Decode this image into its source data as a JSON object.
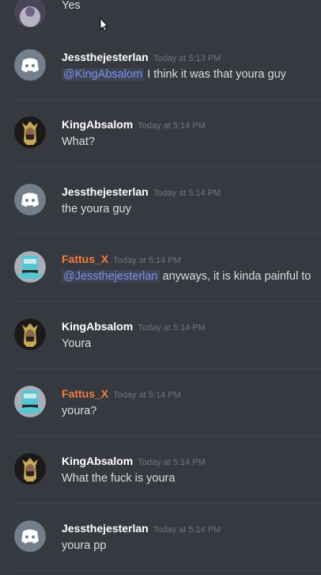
{
  "top_partial": {
    "content": "Yes"
  },
  "messages": [
    {
      "author": "Jessthejesterlan",
      "timestamp": "Today at 5:13 PM",
      "mention": "@KingAbsalom",
      "text": "I think it was that youra guy",
      "avatar": "discord-logo-icon"
    },
    {
      "author": "KingAbsalom",
      "timestamp": "Today at 5:14 PM",
      "mention": "",
      "text": "What?",
      "avatar": "king-avatar"
    },
    {
      "author": "Jessthejesterlan",
      "timestamp": "Today at 5:14 PM",
      "mention": "",
      "text": "the youra guy",
      "avatar": "discord-logo-icon"
    },
    {
      "author": "Fattus_X",
      "timestamp": "Today at 5:14 PM",
      "mention": "@Jessthejesterlan",
      "text": "anyways, it is kinda painful to",
      "avatar": "hat-avatar"
    },
    {
      "author": "KingAbsalom",
      "timestamp": "Today at 5:14 PM",
      "mention": "",
      "text": "Youra",
      "avatar": "king-avatar"
    },
    {
      "author": "Fattus_X",
      "timestamp": "Today at 5:14 PM",
      "mention": "",
      "text": "youra?",
      "avatar": "hat-avatar"
    },
    {
      "author": "KingAbsalom",
      "timestamp": "Today at 5:14 PM",
      "mention": "",
      "text": "What the fuck is youra",
      "avatar": "king-avatar"
    },
    {
      "author": "Jessthejesterlan",
      "timestamp": "Today at 5:14 PM",
      "mention": "",
      "text": "youra pp",
      "avatar": "discord-logo-icon"
    }
  ],
  "colors": {
    "background": "#36393f",
    "username_default": "#ffffff",
    "username_role": "#f47b41",
    "mention": "#7d93e6",
    "timestamp": "#72767d"
  }
}
